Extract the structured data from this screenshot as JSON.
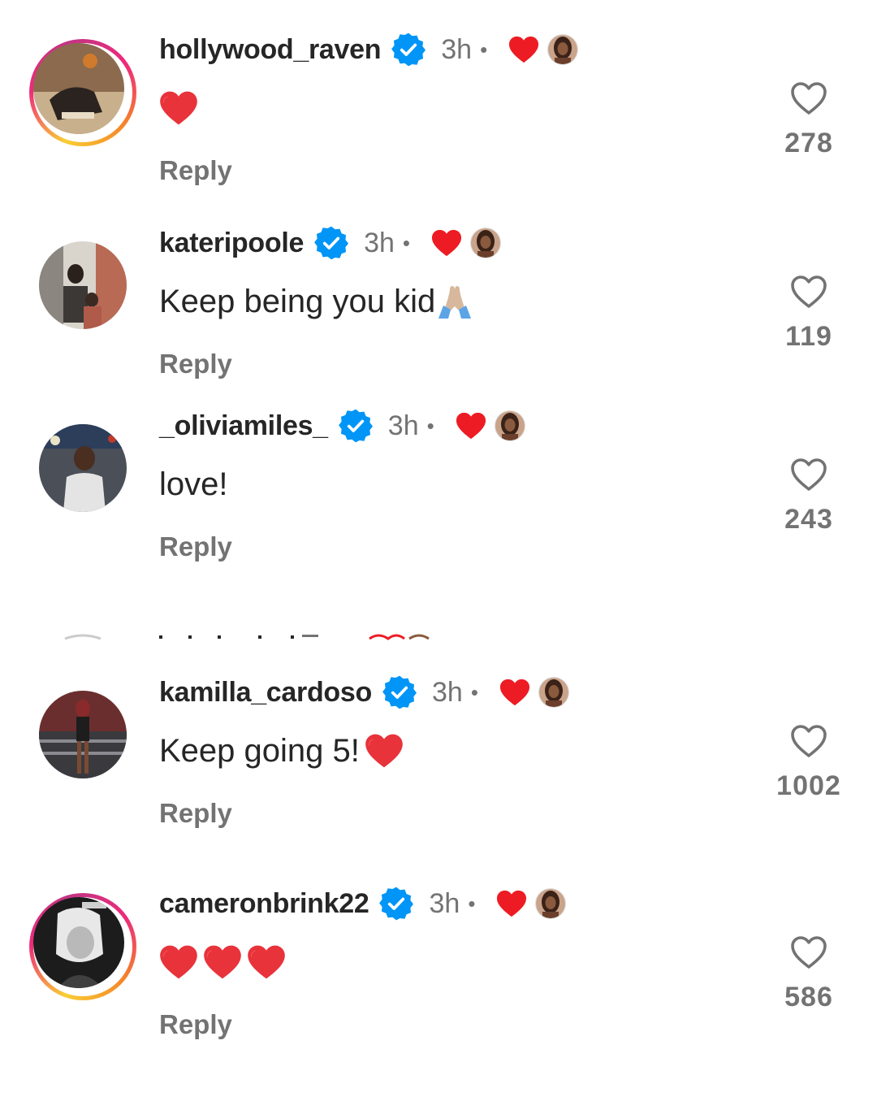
{
  "colors": {
    "verified": "#0095f6",
    "heart": "#ed1c24",
    "muted": "#737373",
    "text": "#262626"
  },
  "comments": [
    {
      "username": "hollywood_raven",
      "time": "3h",
      "dot": "•",
      "text": "",
      "reply": "Reply",
      "likes": "278",
      "story_ring": true
    },
    {
      "username": "kateripoole",
      "time": "3h",
      "dot": "•",
      "text": "Keep being you kid",
      "reply": "Reply",
      "likes": "119",
      "story_ring": false
    },
    {
      "username": "_oliviamiles_",
      "time": "3h",
      "dot": "•",
      "text": "love!",
      "reply": "Reply",
      "likes": "243",
      "story_ring": false
    },
    {
      "username": "kamilla_cardoso",
      "time": "3h",
      "dot": "•",
      "text": "Keep going 5!",
      "reply": "Reply",
      "likes": "1002",
      "story_ring": false
    },
    {
      "username": "cameronbrink22",
      "time": "3h",
      "dot": "•",
      "text": "",
      "reply": "Reply",
      "likes": "586",
      "story_ring": true
    }
  ],
  "icons": {
    "verified": "verified-badge-icon",
    "liked_by_creator": "heart-icon",
    "like": "heart-outline-icon",
    "emoji_heart": "red-heart-emoji",
    "emoji_pray": "folded-hands-emoji"
  }
}
